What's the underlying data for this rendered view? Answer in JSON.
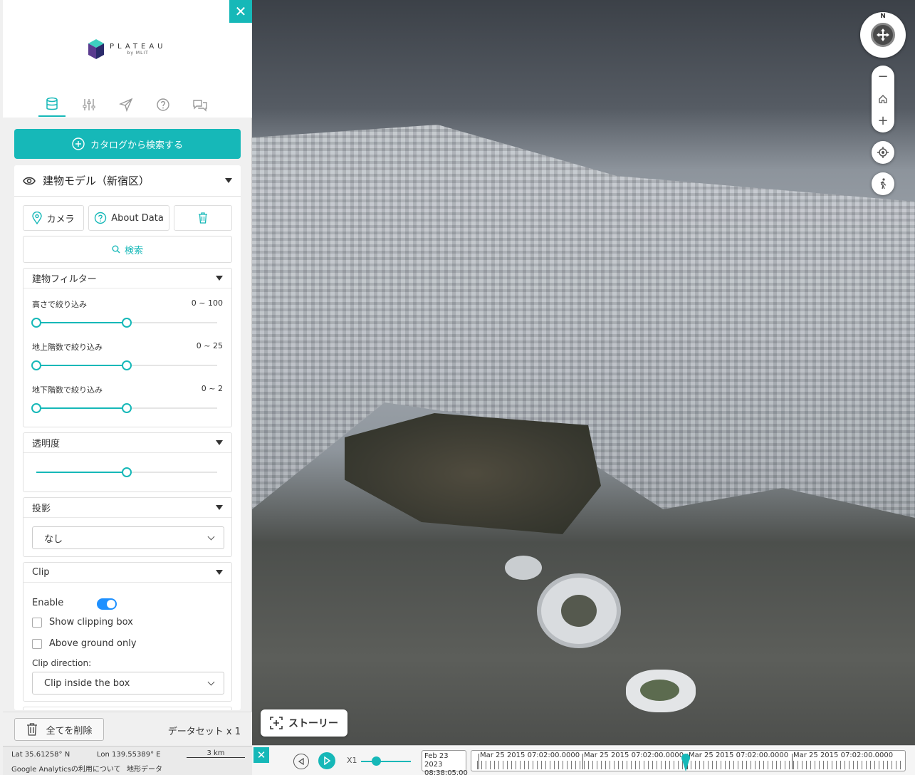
{
  "sidebar": {
    "close_label": "✕",
    "logo": {
      "name": "PLATEAU",
      "sub": "by MLIT"
    },
    "tabs": [
      "database-icon",
      "sliders-icon",
      "send-icon",
      "help-icon",
      "chat-icon"
    ],
    "catalog_button": "カタログから検索する",
    "layer": {
      "title": "建物モデル（新宿区）",
      "camera_label": "カメラ",
      "about_label": "About Data",
      "search_label": "検索",
      "filter": {
        "title": "建物フィルター",
        "rows": [
          {
            "label": "高さで絞り込み",
            "range": "0 ~ 100",
            "fill": 0.5
          },
          {
            "label": "地上階数で絞り込み",
            "range": "0 ~ 25",
            "fill": 0.5
          },
          {
            "label": "地下階数で絞り込み",
            "range": "0 ~ 2",
            "fill": 0.5
          }
        ]
      },
      "opacity": {
        "title": "透明度",
        "value": 0.5
      },
      "shadow": {
        "title": "投影",
        "selected": "なし"
      },
      "clip": {
        "title": "Clip",
        "enable_label": "Enable",
        "enable": true,
        "show_box_label": "Show clipping box",
        "above_ground_label": "Above ground only",
        "direction_label": "Clip direction:",
        "direction_selected": "Clip inside the box"
      }
    },
    "delete_all_label": "全てを削除",
    "dataset_count": "データセット x 1"
  },
  "footer": {
    "lat": "Lat  35.61258° N",
    "lon": "Lon  139.55389° E",
    "scale": "3 km",
    "ga_link": "Google Analyticsの利用について",
    "terrain_link": "地形データ"
  },
  "map": {
    "compass_n": "N",
    "zoom_out": "−",
    "zoom_in": "+",
    "story_label": "ストーリー"
  },
  "timeline": {
    "speed": "X1",
    "current_date": "Feb 23 2023",
    "current_time": "08:38:05.00",
    "scale_labels": [
      "Mar 25 2015 07:02:00.0000",
      "Mar 25 2015 07:02:00.0000",
      "Mar 25 2015 07:02:00.0000",
      "Mar 25 2015 07:02:00.0000"
    ]
  },
  "colors": {
    "accent": "#16b8b8",
    "toggle": "#1e90ff"
  }
}
